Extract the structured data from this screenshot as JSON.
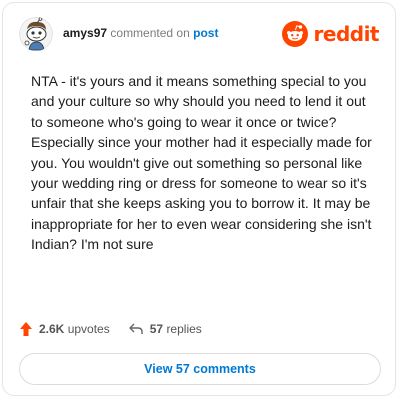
{
  "comment": {
    "username": "amys97",
    "action_text": "commented on",
    "target_link": "post",
    "body": "NTA - it's yours and it means something special to you and your culture so why should you need to lend it out to someone who's going to wear it once or twice? Especially since your mother had it especially made for you. You wouldn't give out something so personal like your wedding ring or dress for someone to wear so it's unfair that she keeps asking you to borrow it. It may be inappropriate for her to even wear considering she isn't Indian? I'm not sure"
  },
  "brand": {
    "name": "reddit",
    "color": "#ff4500",
    "icon": "reddit-snoo-icon"
  },
  "stats": {
    "upvotes": "2.6K",
    "upvotes_label": "upvotes",
    "upvote_icon": "upvote-arrow-icon",
    "upvote_color": "#ff4500",
    "replies": "57",
    "replies_label": "replies",
    "reply_icon": "reply-arrow-icon"
  },
  "view_button": {
    "label": "View 57 comments",
    "color": "#0079d3"
  },
  "avatar": {
    "icon": "snoo-avatar-icon"
  }
}
